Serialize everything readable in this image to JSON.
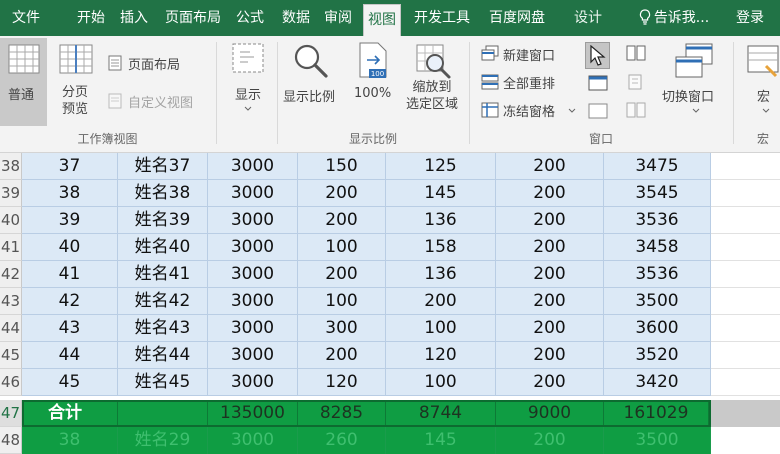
{
  "tabs": [
    {
      "id": "file",
      "label": "文件"
    },
    {
      "id": "home",
      "label": "开始"
    },
    {
      "id": "insert",
      "label": "插入"
    },
    {
      "id": "layout",
      "label": "页面布局"
    },
    {
      "id": "formula",
      "label": "公式"
    },
    {
      "id": "data",
      "label": "数据"
    },
    {
      "id": "review",
      "label": "审阅"
    },
    {
      "id": "view",
      "label": "视图",
      "active": true
    },
    {
      "id": "developer",
      "label": "开发工具"
    },
    {
      "id": "baidu",
      "label": "百度网盘"
    },
    {
      "id": "design",
      "label": "设计"
    },
    {
      "id": "tellme",
      "label": "告诉我..."
    },
    {
      "id": "login",
      "label": "登录"
    }
  ],
  "ribbon": {
    "workbook_views": {
      "normal": "普通",
      "page_break_line1": "分页",
      "page_break_line2": "预览",
      "page_layout": "页面布局",
      "custom_view": "自定义视图",
      "group_label": "工作簿视图"
    },
    "show": {
      "label": "显示"
    },
    "zoom": {
      "zoom": "显示比例",
      "hundred": "100%",
      "to_selection_line1": "缩放到",
      "to_selection_line2": "选定区域",
      "group_label": "显示比例"
    },
    "window": {
      "new_window": "新建窗口",
      "arrange_all": "全部重排",
      "freeze_panes": "冻结窗格",
      "switch_windows": "切换窗口",
      "group_label": "窗口"
    },
    "macros": {
      "label": "宏",
      "group_label": "宏"
    }
  },
  "rows": [
    {
      "num": "38",
      "cells": [
        "37",
        "姓名37",
        "3000",
        "150",
        "125",
        "200",
        "3475"
      ]
    },
    {
      "num": "39",
      "cells": [
        "38",
        "姓名38",
        "3000",
        "200",
        "145",
        "200",
        "3545"
      ]
    },
    {
      "num": "40",
      "cells": [
        "39",
        "姓名39",
        "3000",
        "200",
        "136",
        "200",
        "3536"
      ]
    },
    {
      "num": "41",
      "cells": [
        "40",
        "姓名40",
        "3000",
        "100",
        "158",
        "200",
        "3458"
      ]
    },
    {
      "num": "42",
      "cells": [
        "41",
        "姓名41",
        "3000",
        "200",
        "136",
        "200",
        "3536"
      ]
    },
    {
      "num": "43",
      "cells": [
        "42",
        "姓名42",
        "3000",
        "100",
        "200",
        "200",
        "3500"
      ]
    },
    {
      "num": "44",
      "cells": [
        "43",
        "姓名43",
        "3000",
        "300",
        "100",
        "200",
        "3600"
      ]
    },
    {
      "num": "45",
      "cells": [
        "44",
        "姓名44",
        "3000",
        "200",
        "120",
        "200",
        "3520"
      ]
    },
    {
      "num": "46",
      "cells": [
        "45",
        "姓名45",
        "3000",
        "120",
        "100",
        "200",
        "3420"
      ]
    }
  ],
  "total": {
    "num": "47",
    "label": "合计",
    "cells": [
      "",
      "135000",
      "8285",
      "8744",
      "9000",
      "161029"
    ]
  },
  "below": {
    "num": "48",
    "cells": [
      "38",
      "姓名29",
      "3000",
      "260",
      "145",
      "200",
      "3500"
    ]
  },
  "colors": {
    "ribbon_green": "#217346",
    "row_blue": "#dce9f6",
    "total_green": "#0f9d43"
  }
}
